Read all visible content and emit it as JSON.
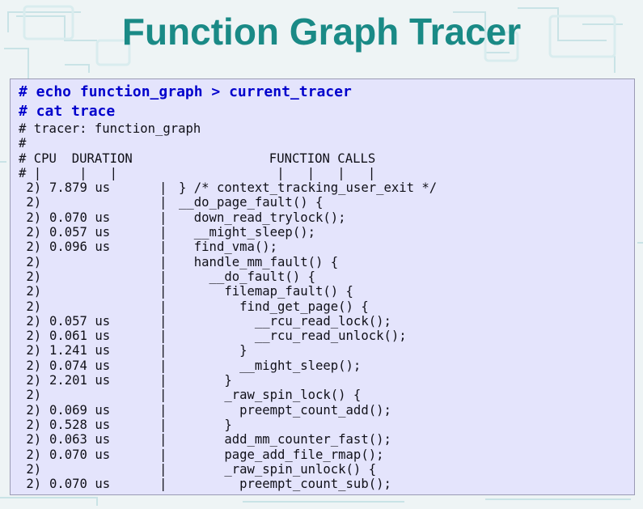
{
  "slide": {
    "title": "Function Graph Tracer"
  },
  "terminal": {
    "commands": [
      "# echo function_graph > current_tracer",
      "# cat trace"
    ],
    "header_lines": [
      "# tracer: function_graph",
      "#",
      "# CPU  DURATION                  FUNCTION CALLS",
      "# |     |   |                     |   |   |   |"
    ],
    "rows": [
      {
        "cpu": " 2)",
        "duration": "7.879 us",
        "bar": "|",
        "call": "} /* context_tracking_user_exit */"
      },
      {
        "cpu": " 2)",
        "duration": "",
        "bar": "|",
        "call": "__do_page_fault() {"
      },
      {
        "cpu": " 2)",
        "duration": "0.070 us",
        "bar": "|",
        "call": "  down_read_trylock();"
      },
      {
        "cpu": " 2)",
        "duration": "0.057 us",
        "bar": "|",
        "call": "  __might_sleep();"
      },
      {
        "cpu": " 2)",
        "duration": "0.096 us",
        "bar": "|",
        "call": "  find_vma();"
      },
      {
        "cpu": " 2)",
        "duration": "",
        "bar": "|",
        "call": "  handle_mm_fault() {"
      },
      {
        "cpu": " 2)",
        "duration": "",
        "bar": "|",
        "call": "    __do_fault() {"
      },
      {
        "cpu": " 2)",
        "duration": "",
        "bar": "|",
        "call": "      filemap_fault() {"
      },
      {
        "cpu": " 2)",
        "duration": "",
        "bar": "|",
        "call": "        find_get_page() {"
      },
      {
        "cpu": " 2)",
        "duration": "0.057 us",
        "bar": "|",
        "call": "          __rcu_read_lock();"
      },
      {
        "cpu": " 2)",
        "duration": "0.061 us",
        "bar": "|",
        "call": "          __rcu_read_unlock();"
      },
      {
        "cpu": " 2)",
        "duration": "1.241 us",
        "bar": "|",
        "call": "        }"
      },
      {
        "cpu": " 2)",
        "duration": "0.074 us",
        "bar": "|",
        "call": "        __might_sleep();"
      },
      {
        "cpu": " 2)",
        "duration": "2.201 us",
        "bar": "|",
        "call": "      }"
      },
      {
        "cpu": " 2)",
        "duration": "",
        "bar": "|",
        "call": "      _raw_spin_lock() {"
      },
      {
        "cpu": " 2)",
        "duration": "0.069 us",
        "bar": "|",
        "call": "        preempt_count_add();"
      },
      {
        "cpu": " 2)",
        "duration": "0.528 us",
        "bar": "|",
        "call": "      }"
      },
      {
        "cpu": " 2)",
        "duration": "0.063 us",
        "bar": "|",
        "call": "      add_mm_counter_fast();"
      },
      {
        "cpu": " 2)",
        "duration": "0.070 us",
        "bar": "|",
        "call": "      page_add_file_rmap();"
      },
      {
        "cpu": " 2)",
        "duration": "",
        "bar": "|",
        "call": "      _raw_spin_unlock() {"
      },
      {
        "cpu": " 2)",
        "duration": "0.070 us",
        "bar": "|",
        "call": "        preempt_count_sub();"
      }
    ]
  },
  "colors": {
    "title": "#1a8a86",
    "command": "#0000cc",
    "terminal_bg": "#e4e4fc",
    "text": "#101018"
  }
}
